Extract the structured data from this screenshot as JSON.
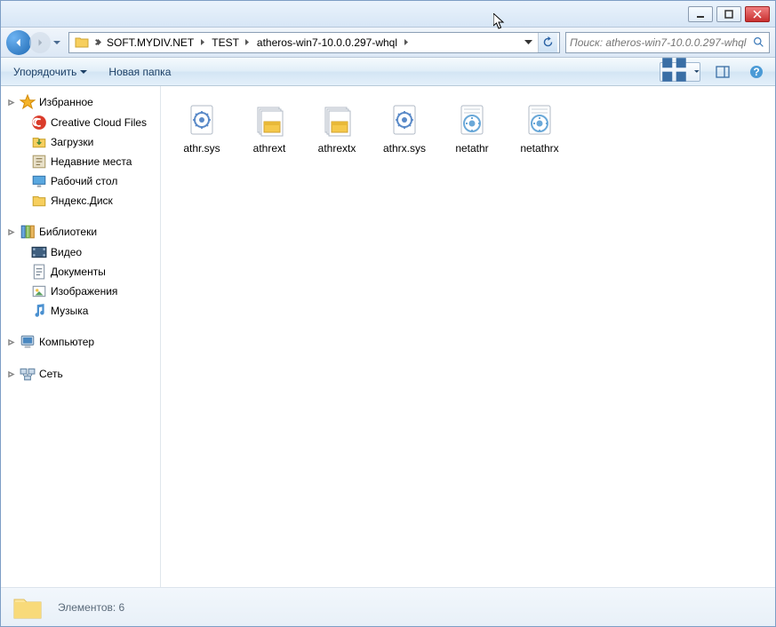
{
  "window": {
    "breadcrumbs": [
      {
        "label": "SOFT.MYDIV.NET"
      },
      {
        "label": "TEST"
      },
      {
        "label": "atheros-win7-10.0.0.297-whql"
      }
    ],
    "search_placeholder": "Поиск: atheros-win7-10.0.0.297-whql"
  },
  "toolbar": {
    "organize": "Упорядочить",
    "newfolder": "Новая папка"
  },
  "sidebar": {
    "favorites": {
      "label": "Избранное",
      "items": [
        {
          "label": "Creative Cloud Files",
          "icon": "cc"
        },
        {
          "label": "Загрузки",
          "icon": "downloads"
        },
        {
          "label": "Недавние места",
          "icon": "recent"
        },
        {
          "label": "Рабочий стол",
          "icon": "desktop"
        },
        {
          "label": "Яндекс.Диск",
          "icon": "folder"
        }
      ]
    },
    "libraries": {
      "label": "Библиотеки",
      "items": [
        {
          "label": "Видео",
          "icon": "video"
        },
        {
          "label": "Документы",
          "icon": "doc"
        },
        {
          "label": "Изображения",
          "icon": "image"
        },
        {
          "label": "Музыка",
          "icon": "music"
        }
      ]
    },
    "computer": {
      "label": "Компьютер"
    },
    "network": {
      "label": "Сеть"
    }
  },
  "files": [
    {
      "name": "athr.sys",
      "icon": "sys"
    },
    {
      "name": "athrext",
      "icon": "cab"
    },
    {
      "name": "athrextx",
      "icon": "cab"
    },
    {
      "name": "athrx.sys",
      "icon": "sys"
    },
    {
      "name": "netathr",
      "icon": "inf"
    },
    {
      "name": "netathrx",
      "icon": "inf"
    }
  ],
  "status": {
    "text": "Элементов: 6"
  }
}
